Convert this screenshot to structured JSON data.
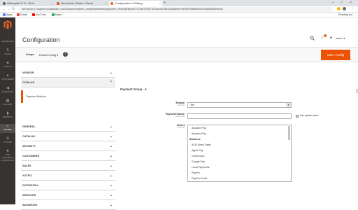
{
  "browser": {
    "tabs": [
      {
        "title": "Globaplain P. 3 - Glob",
        "fav": "#5f6368"
      },
      {
        "title": "New Node / Notes / Permi",
        "fav": "#e34c26"
      },
      {
        "title": "Configuration / Setting",
        "fav": "#f26322"
      }
    ],
    "url": "Not secure | magento.local/admin_mz202/admin/system_config/edit/section/payment_methods/key/874714e877f0d7197acca4196e152ad69e47ee9f07b3d6f016d4765ad45435e02a/",
    "bookmarks": [
      "Apps",
      "Gmail",
      "YouTube",
      "Maps"
    ],
    "reading_list": "Reading list"
  },
  "sidebar": {
    "items": [
      {
        "label": "DASHBOARD",
        "icon": "speedometer-icon"
      },
      {
        "label": "SALES",
        "icon": "dollar-icon"
      },
      {
        "label": "CATALOG",
        "icon": "cube-icon"
      },
      {
        "label": "CUSTOMERS",
        "icon": "person-icon"
      },
      {
        "label": "MARKETING",
        "icon": "megaphone-icon"
      },
      {
        "label": "CONTENT",
        "icon": "layout-icon"
      },
      {
        "label": "REPORTS",
        "icon": "bar-chart-icon"
      },
      {
        "label": "STORES",
        "icon": "store-icon"
      },
      {
        "label": "SYSTEM",
        "icon": "gear-icon"
      },
      {
        "label": "FIND PARTNERS & EXTENSIONS",
        "icon": "puzzle-icon"
      }
    ]
  },
  "header": {
    "title": "Configuration",
    "user": "admin",
    "notifications": "1"
  },
  "scope": {
    "label": "Scope:",
    "value": "Default Config",
    "help": "?"
  },
  "toolbar": {
    "save_label": "Save Config"
  },
  "left_tabs": [
    {
      "label": "VENDOR",
      "open": false
    },
    {
      "label": "CODILAR",
      "open": true,
      "sub": "Payment Method"
    },
    {
      "label": "GENERAL"
    },
    {
      "label": "CATALOG"
    },
    {
      "label": "SECURITY"
    },
    {
      "label": "CUSTOMERS"
    },
    {
      "label": "SALES"
    },
    {
      "label": "YOTPO"
    },
    {
      "label": "DOTDIGITAL"
    },
    {
      "label": "SERVICES"
    },
    {
      "label": "ADVANCED"
    }
  ],
  "content": {
    "group_title": "Payment Group - A",
    "enable": {
      "label": "Enable",
      "scope": "[website]",
      "value": "Yes"
    },
    "payment_name": {
      "label": "Payment Name",
      "scope": "[store view]",
      "value": ""
    },
    "use_system_value": "Use system value",
    "select": {
      "label": "Select",
      "scope": "[website]"
    },
    "options": [
      {
        "text": "Amazon Pay",
        "group": false
      },
      {
        "text": "Amazon Pay",
        "group": false
      },
      {
        "text": "Braintree",
        "group": true
      },
      {
        "text": "ACH Direct Debit",
        "group": false
      },
      {
        "text": "Apple Pay",
        "group": false
      },
      {
        "text": "Credit Card",
        "group": false
      },
      {
        "text": "Google Pay",
        "group": false
      },
      {
        "text": "Local Payments",
        "group": false
      },
      {
        "text": "PayPal",
        "group": false
      },
      {
        "text": "PayPal Credit",
        "group": false
      }
    ]
  },
  "colors": {
    "accent": "#eb5202",
    "sidebar_bg": "#373330"
  }
}
